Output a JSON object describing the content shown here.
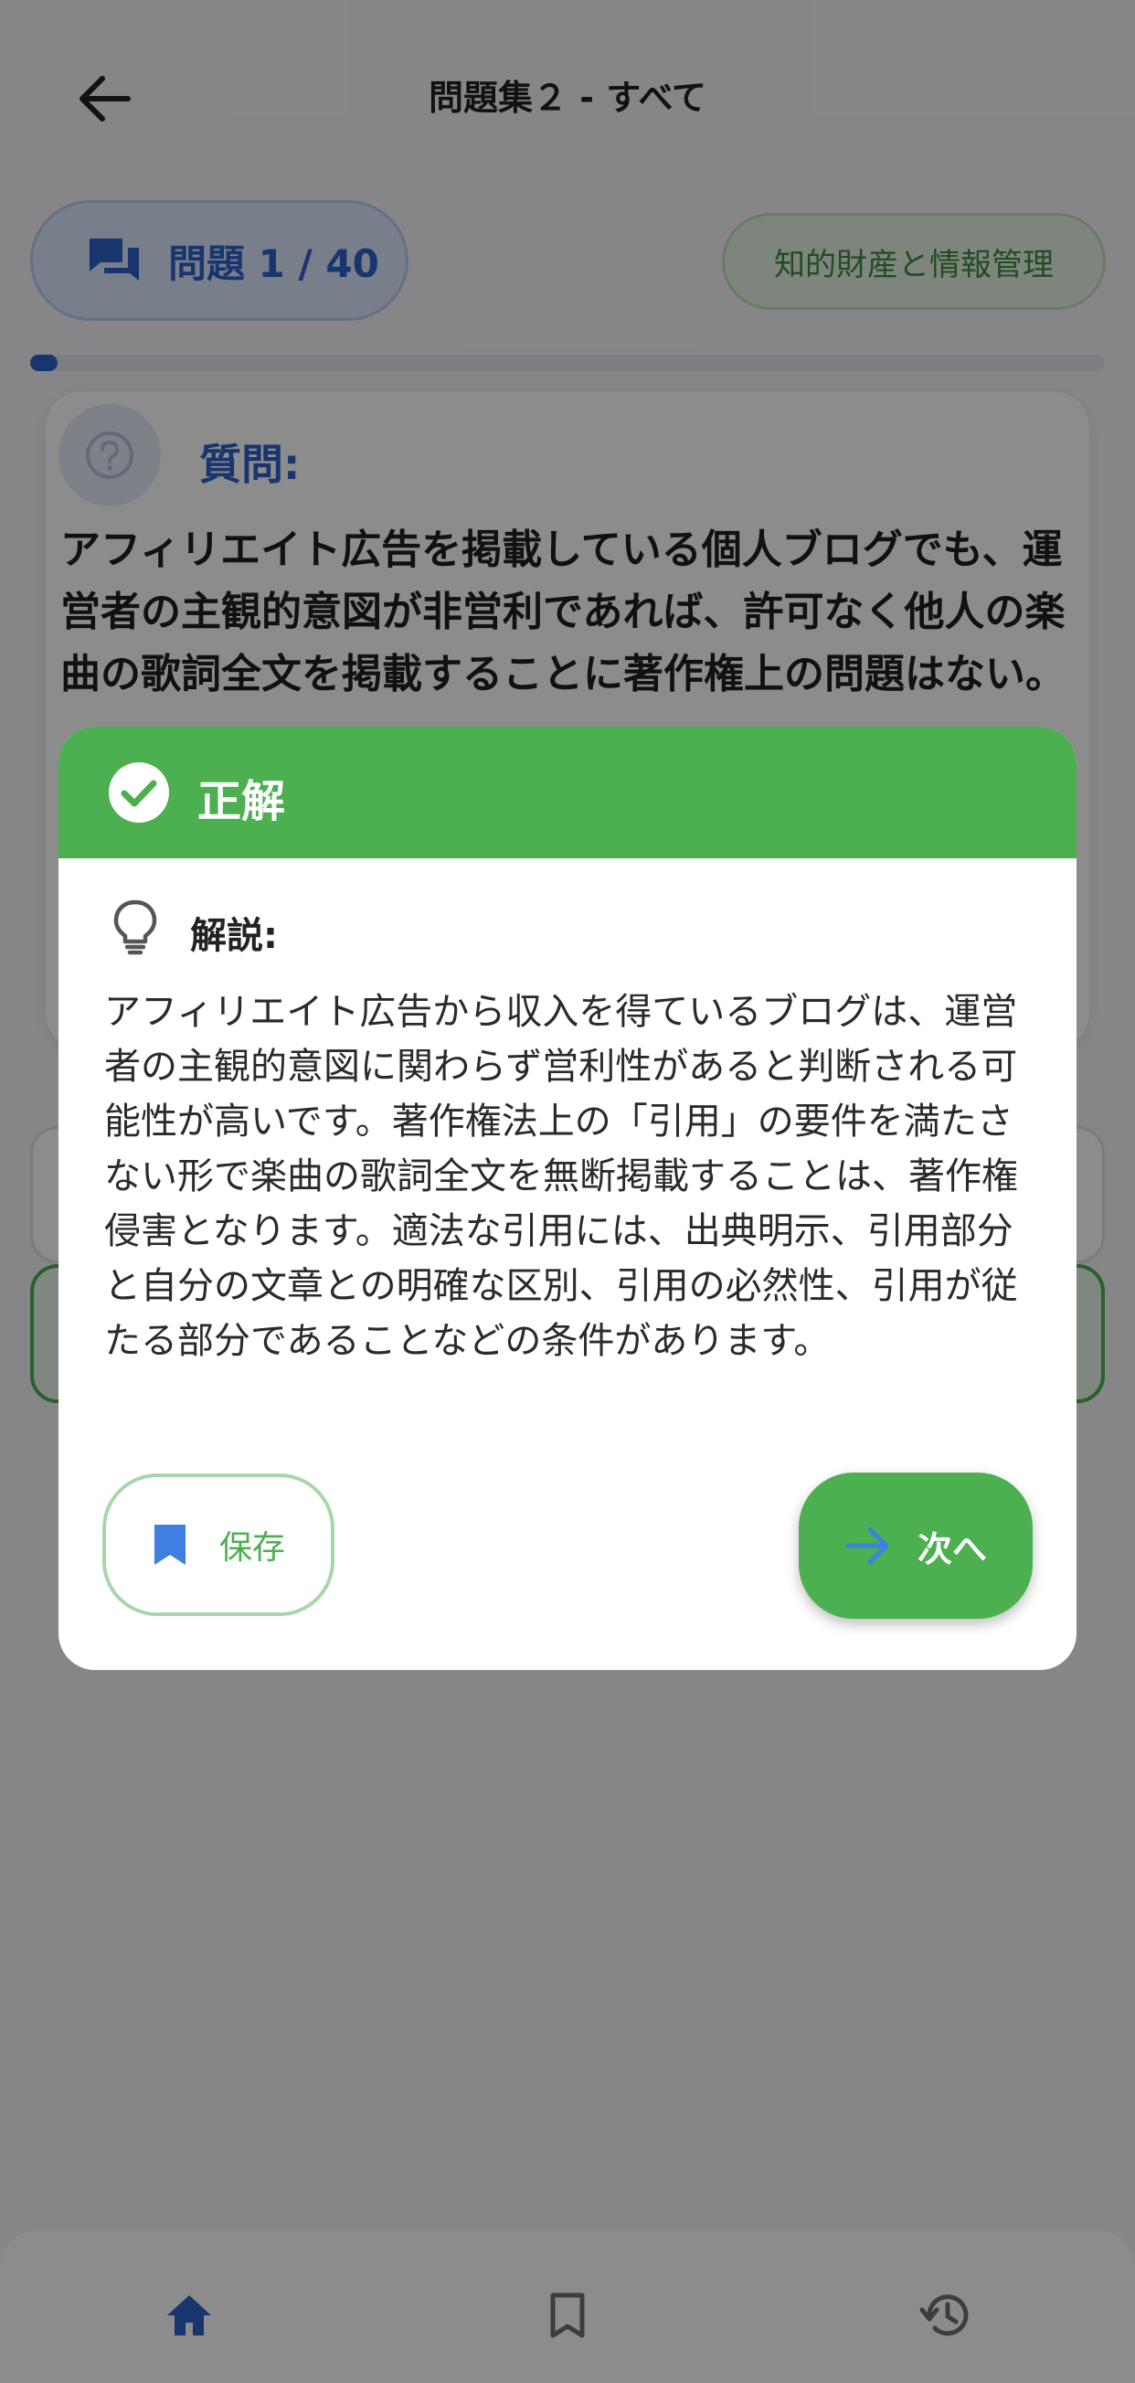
{
  "app_bar": {
    "back_icon": "arrow-back-icon",
    "title": "問題集２ - すべて"
  },
  "question_header": {
    "counter_icon": "chat-bubbles-icon",
    "counter_label": "問題 1 / 40",
    "current": 1,
    "total": 40,
    "category": "知的財産と情報管理"
  },
  "progress": {
    "fraction": 0.025,
    "color": "#2e62c9"
  },
  "question": {
    "icon": "question-circle-icon",
    "label": "質問:",
    "text": "アフィリエイト広告を掲載している個人ブログでも、運営者の主観的意図が非営利であれば、許可なく他人の楽曲の歌詞全文を掲載することに著作権上の問題はない。"
  },
  "result_dialog": {
    "status_icon": "check-circle-icon",
    "status_title": "正解",
    "explanation_icon": "lightbulb-icon",
    "explanation_label": "解説:",
    "explanation_text": "アフィリエイト広告から収入を得ているブログは、運営者の主観的意図に関わらず営利性があると判断される可能性が高いです。著作権法上の「引用」の要件を満たさない形で楽曲の歌詞全文を無断掲載することは、著作権侵害となります。適法な引用には、出典明示、引用部分と自分の文章との明確な区別、引用の必然性、引用が従たる部分であることなどの条件があります。",
    "save_icon": "bookmark-icon",
    "save_label": "保存",
    "next_icon": "arrow-forward-icon",
    "next_label": "次へ"
  },
  "bottom_nav": {
    "items": [
      {
        "icon": "home-icon",
        "active": true
      },
      {
        "icon": "bookmark-outline-icon",
        "active": false
      },
      {
        "icon": "history-icon",
        "active": false
      }
    ]
  },
  "colors": {
    "primary_blue": "#2e62c9",
    "success_green": "#4caf50",
    "scrim": "rgba(0,0,0,0.45)"
  }
}
